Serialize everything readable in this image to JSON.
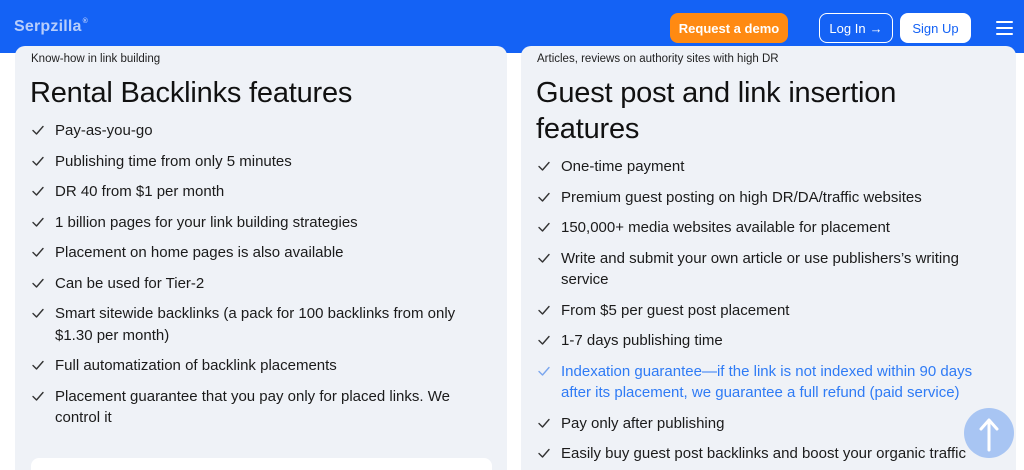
{
  "header": {
    "logo": "Serpzilla",
    "logo_mark": "®",
    "demo_button": "Request a demo",
    "login_button": "Log In",
    "login_arrow": "→",
    "signup_button": "Sign Up",
    "menu_icon": "hamburger-menu-icon"
  },
  "left_card": {
    "eyebrow": "Know-how in link building",
    "heading": "Rental Backlinks features",
    "items": [
      "Pay-as-you-go",
      "Publishing time from only 5 minutes",
      "DR 40 from $1 per month",
      "1 billion pages for your link building strategies",
      "Placement on home pages is also available",
      "Can be used for Tier-2",
      "Smart sitewide backlinks (a pack for 100 backlinks from only $1.30 per month)",
      "Full automatization of backlink placements",
      "Placement guarantee that you pay only for placed links. We control it"
    ]
  },
  "right_card": {
    "eyebrow": "Articles, reviews on authority sites with high DR",
    "heading_line1": "Guest post and link insertion",
    "heading_line2": "features",
    "items": [
      "One-time payment",
      "Premium guest posting on high DR/DA/traffic websites",
      "150,000+ media websites available for placement",
      "Write and submit your own article or use publishers’s writing service",
      "From $5 per guest post placement",
      "1-7 days publishing time",
      "Indexation guarantee—if the link is not indexed within 90 days after its placement, we guarantee a full refund (paid service)",
      "Pay only after publishing",
      "Easily buy guest post backlinks and boost your organic traffic"
    ]
  },
  "colors": {
    "topbar": "#1462f5",
    "demo_button": "#ff8a12",
    "card_bg": "#eff2f7",
    "highlight_text": "#2f7bf5"
  },
  "scroll_top_icon": "arrow-up-icon"
}
